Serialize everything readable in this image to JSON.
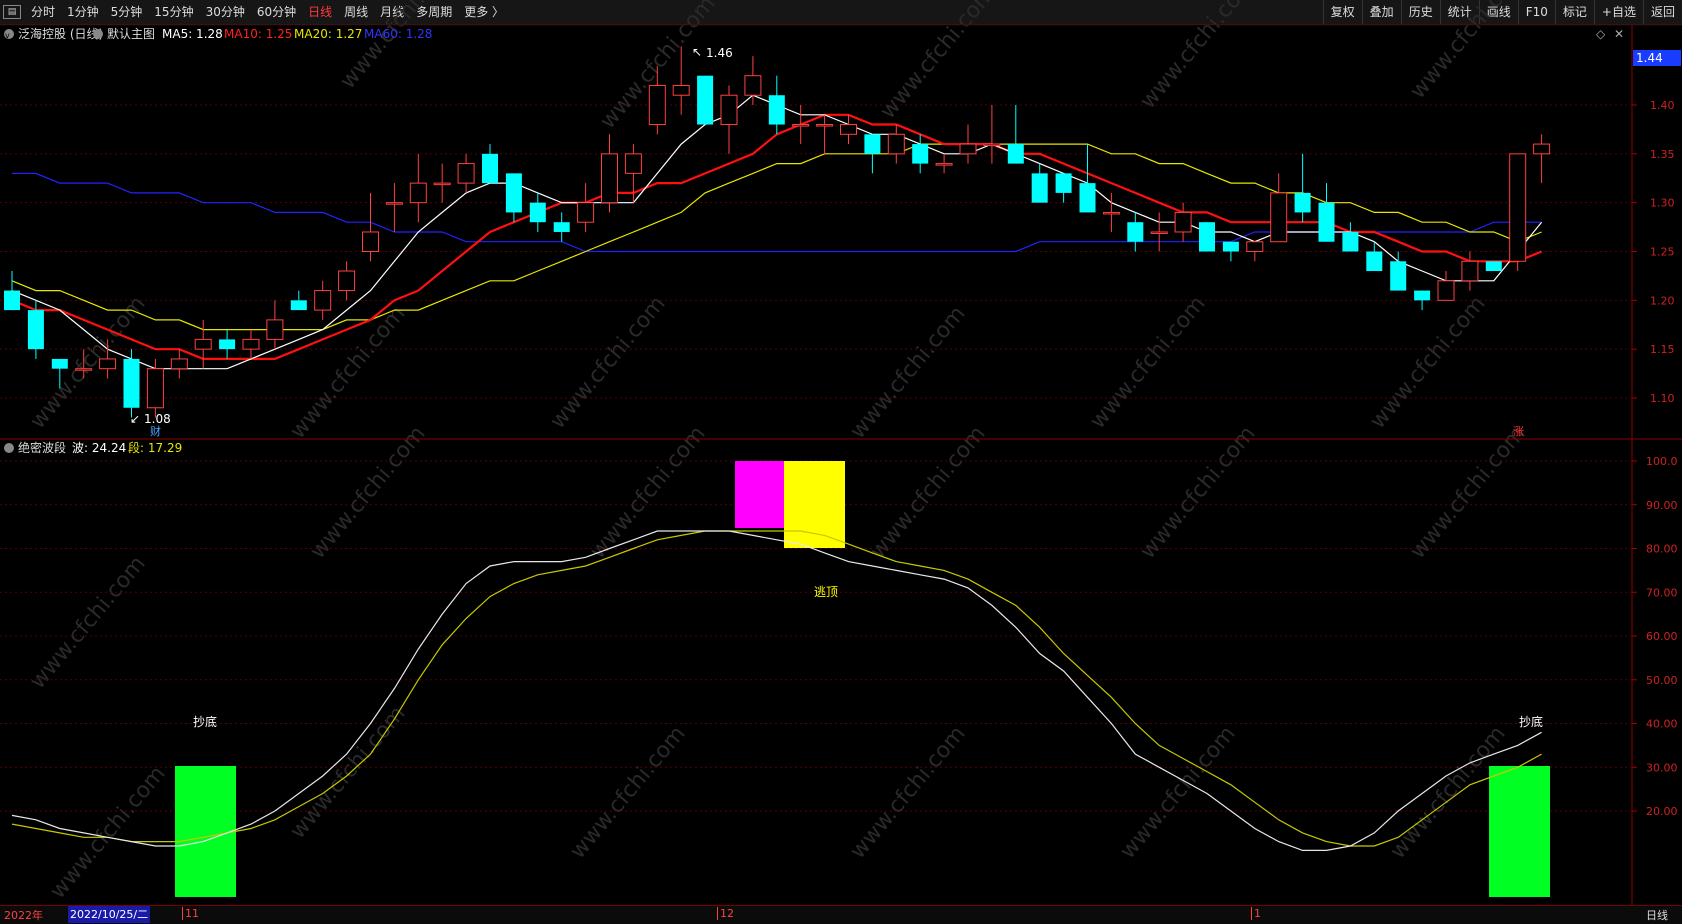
{
  "topbar": {
    "periods": [
      "分时",
      "1分钟",
      "5分钟",
      "15分钟",
      "30分钟",
      "60分钟",
      "日线",
      "周线",
      "月线",
      "多周期",
      "更多 〉"
    ],
    "active_period": "日线",
    "tools": [
      "复权",
      "叠加",
      "历史",
      "统计",
      "画线",
      "F10",
      "标记",
      "+自选",
      "返回"
    ]
  },
  "main_legend": {
    "stock": "泛海控股 (日线)",
    "template": "默认主图",
    "ma5": "MA5: 1.28",
    "ma10": "MA10: 1.25",
    "ma20": "MA20: 1.27",
    "ma60": "MA60: 1.28"
  },
  "sub_legend": {
    "name": "绝密波段",
    "wave": "波: 24.24",
    "segment": "段: 17.29"
  },
  "price_axis": {
    "current_price": "1.44",
    "ticks": [
      "1.40",
      "1.35",
      "1.30",
      "1.25",
      "1.20",
      "1.15",
      "1.10"
    ]
  },
  "sub_axis": {
    "ticks": [
      "100.0",
      "90.00",
      "80.00",
      "70.00",
      "60.00",
      "50.00",
      "40.00",
      "30.00",
      "20.00"
    ]
  },
  "annotations": {
    "high_label": "1.46",
    "low_label": "1.08",
    "fin_marker": "财",
    "rise_marker": "涨",
    "buy_left": "抄底",
    "sell_top": "逃顶",
    "buy_right": "抄底"
  },
  "bottom": {
    "year": "2022年",
    "cursor_date": "2022/10/25/二",
    "month_labels": [
      "11",
      "12",
      "1"
    ],
    "period_tab": "日线"
  },
  "watermark": "www.cfchi.com",
  "colors": {
    "up_candle": "#ff4040",
    "down_candle": "#00ffff",
    "ma5": "#ffffff",
    "ma10": "#ff1010",
    "ma20": "#e6e600",
    "ma60": "#2222ff",
    "buy_block": "#00ff22",
    "top_block_magenta": "#ff00ff",
    "top_block_yellow": "#ffff00"
  },
  "chart_data": [
    {
      "type": "candlestick",
      "title": "泛海控股 (日线)",
      "ylim": [
        1.06,
        1.48
      ],
      "candles": [
        {
          "o": 1.21,
          "h": 1.23,
          "l": 1.19,
          "c": 1.19
        },
        {
          "o": 1.19,
          "h": 1.2,
          "l": 1.14,
          "c": 1.15
        },
        {
          "o": 1.14,
          "h": 1.14,
          "l": 1.11,
          "c": 1.13
        },
        {
          "o": 1.13,
          "h": 1.15,
          "l": 1.12,
          "c": 1.13
        },
        {
          "o": 1.13,
          "h": 1.16,
          "l": 1.12,
          "c": 1.14
        },
        {
          "o": 1.14,
          "h": 1.15,
          "l": 1.08,
          "c": 1.09
        },
        {
          "o": 1.09,
          "h": 1.14,
          "l": 1.08,
          "c": 1.13
        },
        {
          "o": 1.13,
          "h": 1.15,
          "l": 1.12,
          "c": 1.14
        },
        {
          "o": 1.15,
          "h": 1.18,
          "l": 1.13,
          "c": 1.16
        },
        {
          "o": 1.16,
          "h": 1.17,
          "l": 1.14,
          "c": 1.15
        },
        {
          "o": 1.15,
          "h": 1.17,
          "l": 1.14,
          "c": 1.16
        },
        {
          "o": 1.16,
          "h": 1.2,
          "l": 1.15,
          "c": 1.18
        },
        {
          "o": 1.2,
          "h": 1.21,
          "l": 1.19,
          "c": 1.19
        },
        {
          "o": 1.19,
          "h": 1.22,
          "l": 1.18,
          "c": 1.21
        },
        {
          "o": 1.21,
          "h": 1.24,
          "l": 1.2,
          "c": 1.23
        },
        {
          "o": 1.25,
          "h": 1.31,
          "l": 1.24,
          "c": 1.27
        },
        {
          "o": 1.3,
          "h": 1.32,
          "l": 1.27,
          "c": 1.3
        },
        {
          "o": 1.3,
          "h": 1.35,
          "l": 1.28,
          "c": 1.32
        },
        {
          "o": 1.32,
          "h": 1.34,
          "l": 1.3,
          "c": 1.32
        },
        {
          "o": 1.32,
          "h": 1.35,
          "l": 1.31,
          "c": 1.34
        },
        {
          "o": 1.35,
          "h": 1.36,
          "l": 1.32,
          "c": 1.32
        },
        {
          "o": 1.33,
          "h": 1.33,
          "l": 1.28,
          "c": 1.29
        },
        {
          "o": 1.3,
          "h": 1.31,
          "l": 1.27,
          "c": 1.28
        },
        {
          "o": 1.28,
          "h": 1.29,
          "l": 1.26,
          "c": 1.27
        },
        {
          "o": 1.28,
          "h": 1.32,
          "l": 1.27,
          "c": 1.3
        },
        {
          "o": 1.3,
          "h": 1.37,
          "l": 1.29,
          "c": 1.35
        },
        {
          "o": 1.33,
          "h": 1.36,
          "l": 1.3,
          "c": 1.35
        },
        {
          "o": 1.38,
          "h": 1.44,
          "l": 1.37,
          "c": 1.42
        },
        {
          "o": 1.41,
          "h": 1.46,
          "l": 1.39,
          "c": 1.42
        },
        {
          "o": 1.43,
          "h": 1.43,
          "l": 1.38,
          "c": 1.38
        },
        {
          "o": 1.38,
          "h": 1.42,
          "l": 1.35,
          "c": 1.41
        },
        {
          "o": 1.41,
          "h": 1.45,
          "l": 1.4,
          "c": 1.43
        },
        {
          "o": 1.41,
          "h": 1.43,
          "l": 1.37,
          "c": 1.38
        },
        {
          "o": 1.38,
          "h": 1.4,
          "l": 1.36,
          "c": 1.38
        },
        {
          "o": 1.38,
          "h": 1.39,
          "l": 1.35,
          "c": 1.38
        },
        {
          "o": 1.37,
          "h": 1.39,
          "l": 1.36,
          "c": 1.38
        },
        {
          "o": 1.37,
          "h": 1.37,
          "l": 1.33,
          "c": 1.35
        },
        {
          "o": 1.35,
          "h": 1.38,
          "l": 1.34,
          "c": 1.37
        },
        {
          "o": 1.36,
          "h": 1.37,
          "l": 1.33,
          "c": 1.34
        },
        {
          "o": 1.34,
          "h": 1.35,
          "l": 1.33,
          "c": 1.34
        },
        {
          "o": 1.35,
          "h": 1.38,
          "l": 1.34,
          "c": 1.36
        },
        {
          "o": 1.36,
          "h": 1.4,
          "l": 1.34,
          "c": 1.36
        },
        {
          "o": 1.36,
          "h": 1.4,
          "l": 1.34,
          "c": 1.34
        },
        {
          "o": 1.33,
          "h": 1.34,
          "l": 1.3,
          "c": 1.3
        },
        {
          "o": 1.33,
          "h": 1.33,
          "l": 1.3,
          "c": 1.31
        },
        {
          "o": 1.32,
          "h": 1.36,
          "l": 1.29,
          "c": 1.29
        },
        {
          "o": 1.29,
          "h": 1.31,
          "l": 1.27,
          "c": 1.29
        },
        {
          "o": 1.28,
          "h": 1.29,
          "l": 1.25,
          "c": 1.26
        },
        {
          "o": 1.27,
          "h": 1.29,
          "l": 1.25,
          "c": 1.27
        },
        {
          "o": 1.27,
          "h": 1.3,
          "l": 1.26,
          "c": 1.29
        },
        {
          "o": 1.28,
          "h": 1.28,
          "l": 1.25,
          "c": 1.25
        },
        {
          "o": 1.26,
          "h": 1.26,
          "l": 1.24,
          "c": 1.25
        },
        {
          "o": 1.25,
          "h": 1.26,
          "l": 1.24,
          "c": 1.26
        },
        {
          "o": 1.26,
          "h": 1.33,
          "l": 1.26,
          "c": 1.31
        },
        {
          "o": 1.31,
          "h": 1.35,
          "l": 1.28,
          "c": 1.29
        },
        {
          "o": 1.3,
          "h": 1.32,
          "l": 1.26,
          "c": 1.26
        },
        {
          "o": 1.27,
          "h": 1.28,
          "l": 1.25,
          "c": 1.25
        },
        {
          "o": 1.25,
          "h": 1.26,
          "l": 1.23,
          "c": 1.23
        },
        {
          "o": 1.24,
          "h": 1.25,
          "l": 1.21,
          "c": 1.21
        },
        {
          "o": 1.21,
          "h": 1.21,
          "l": 1.19,
          "c": 1.2
        },
        {
          "o": 1.2,
          "h": 1.23,
          "l": 1.2,
          "c": 1.22
        },
        {
          "o": 1.22,
          "h": 1.25,
          "l": 1.21,
          "c": 1.24
        },
        {
          "o": 1.24,
          "h": 1.24,
          "l": 1.23,
          "c": 1.23
        },
        {
          "o": 1.24,
          "h": 1.35,
          "l": 1.23,
          "c": 1.35
        },
        {
          "o": 1.35,
          "h": 1.37,
          "l": 1.32,
          "c": 1.36
        }
      ],
      "ma5": [
        1.21,
        1.2,
        1.19,
        1.17,
        1.15,
        1.14,
        1.13,
        1.13,
        1.13,
        1.13,
        1.14,
        1.15,
        1.16,
        1.17,
        1.19,
        1.21,
        1.24,
        1.27,
        1.29,
        1.31,
        1.32,
        1.32,
        1.31,
        1.3,
        1.3,
        1.3,
        1.3,
        1.33,
        1.36,
        1.38,
        1.39,
        1.41,
        1.4,
        1.39,
        1.39,
        1.38,
        1.37,
        1.37,
        1.36,
        1.35,
        1.35,
        1.36,
        1.35,
        1.34,
        1.33,
        1.32,
        1.3,
        1.29,
        1.28,
        1.28,
        1.27,
        1.27,
        1.26,
        1.27,
        1.27,
        1.27,
        1.27,
        1.26,
        1.24,
        1.23,
        1.22,
        1.22,
        1.22,
        1.25,
        1.28
      ],
      "ma10": [
        1.2,
        1.19,
        1.19,
        1.18,
        1.17,
        1.16,
        1.15,
        1.15,
        1.14,
        1.14,
        1.14,
        1.14,
        1.15,
        1.16,
        1.17,
        1.18,
        1.2,
        1.21,
        1.23,
        1.25,
        1.27,
        1.28,
        1.29,
        1.3,
        1.3,
        1.31,
        1.31,
        1.32,
        1.32,
        1.33,
        1.34,
        1.35,
        1.37,
        1.38,
        1.39,
        1.39,
        1.38,
        1.38,
        1.37,
        1.36,
        1.36,
        1.36,
        1.35,
        1.35,
        1.34,
        1.33,
        1.32,
        1.31,
        1.3,
        1.29,
        1.29,
        1.28,
        1.28,
        1.28,
        1.28,
        1.28,
        1.27,
        1.27,
        1.26,
        1.25,
        1.25,
        1.24,
        1.24,
        1.24,
        1.25
      ],
      "ma20": [
        1.22,
        1.21,
        1.21,
        1.2,
        1.19,
        1.19,
        1.18,
        1.18,
        1.17,
        1.17,
        1.17,
        1.17,
        1.17,
        1.17,
        1.18,
        1.18,
        1.19,
        1.19,
        1.2,
        1.21,
        1.22,
        1.22,
        1.23,
        1.24,
        1.25,
        1.26,
        1.27,
        1.28,
        1.29,
        1.31,
        1.32,
        1.33,
        1.34,
        1.34,
        1.35,
        1.35,
        1.35,
        1.35,
        1.36,
        1.36,
        1.36,
        1.36,
        1.36,
        1.36,
        1.36,
        1.36,
        1.35,
        1.35,
        1.34,
        1.34,
        1.33,
        1.32,
        1.32,
        1.31,
        1.31,
        1.3,
        1.3,
        1.29,
        1.29,
        1.28,
        1.28,
        1.27,
        1.27,
        1.26,
        1.27
      ],
      "ma60": [
        1.33,
        1.33,
        1.32,
        1.32,
        1.32,
        1.31,
        1.31,
        1.31,
        1.3,
        1.3,
        1.3,
        1.29,
        1.29,
        1.29,
        1.28,
        1.28,
        1.27,
        1.27,
        1.27,
        1.26,
        1.26,
        1.26,
        1.26,
        1.26,
        1.25,
        1.25,
        1.25,
        1.25,
        1.25,
        1.25,
        1.25,
        1.25,
        1.25,
        1.25,
        1.25,
        1.25,
        1.25,
        1.25,
        1.25,
        1.25,
        1.25,
        1.25,
        1.25,
        1.26,
        1.26,
        1.26,
        1.26,
        1.26,
        1.26,
        1.26,
        1.26,
        1.26,
        1.27,
        1.27,
        1.27,
        1.27,
        1.27,
        1.27,
        1.27,
        1.27,
        1.27,
        1.27,
        1.28,
        1.28,
        1.28
      ]
    },
    {
      "type": "line",
      "title": "绝密波段",
      "ylim": [
        9,
        100
      ],
      "series": [
        {
          "name": "波",
          "values": [
            19,
            18,
            16,
            15,
            14,
            13,
            12,
            12,
            13,
            15,
            17,
            20,
            24,
            28,
            33,
            40,
            48,
            57,
            65,
            72,
            76,
            77,
            77,
            77,
            78,
            80,
            82,
            84,
            84,
            84,
            84,
            83,
            82,
            81,
            79,
            77,
            76,
            75,
            74,
            73,
            71,
            67,
            62,
            56,
            52,
            46,
            40,
            33,
            30,
            27,
            24,
            20,
            16,
            13,
            11,
            11,
            12,
            15,
            20,
            24,
            28,
            31,
            33,
            35,
            38
          ]
        },
        {
          "name": "段",
          "values": [
            17,
            16,
            15,
            14,
            14,
            13,
            13,
            13,
            14,
            15,
            16,
            18,
            21,
            24,
            28,
            33,
            41,
            50,
            58,
            64,
            69,
            72,
            74,
            75,
            76,
            78,
            80,
            82,
            83,
            84,
            84,
            84,
            84,
            84,
            83,
            81,
            79,
            77,
            76,
            75,
            73,
            70,
            67,
            62,
            56,
            51,
            46,
            40,
            35,
            32,
            29,
            26,
            22,
            18,
            15,
            13,
            12,
            12,
            14,
            18,
            22,
            26,
            28,
            30,
            33
          ]
        }
      ]
    }
  ]
}
